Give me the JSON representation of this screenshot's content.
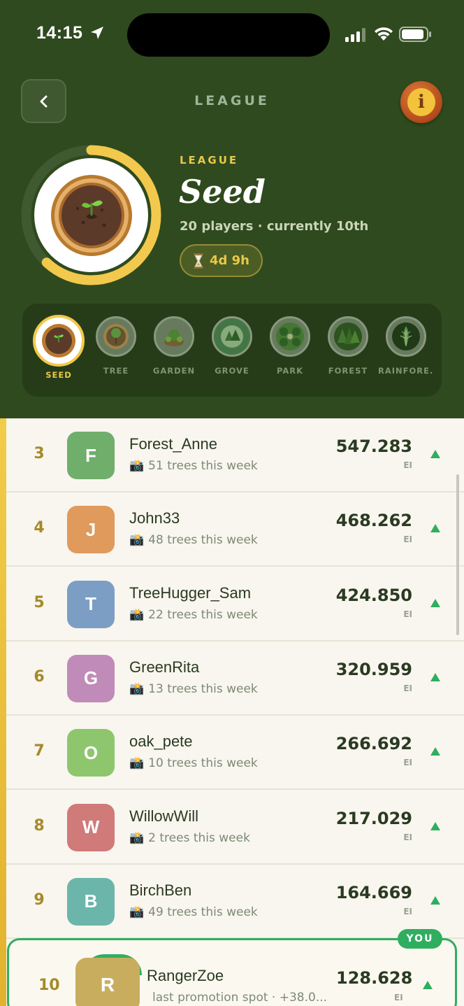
{
  "status_bar": {
    "time": "14:15"
  },
  "header": {
    "title": "LEAGUE",
    "back_icon": "chevron-left-icon",
    "info_icon": "info-icon"
  },
  "league": {
    "label": "LEAGUE",
    "name": "Seed",
    "subtitle": "20 players · currently 10th",
    "timer": "4d 9h",
    "progress_fraction": 0.62,
    "colors": {
      "ring": "#f2c94c",
      "ring_track": "#3f5a30"
    }
  },
  "tiers": [
    {
      "label": "SEED",
      "active": true
    },
    {
      "label": "TREE",
      "active": false
    },
    {
      "label": "GARDEN",
      "active": false
    },
    {
      "label": "GROVE",
      "active": false
    },
    {
      "label": "PARK",
      "active": false
    },
    {
      "label": "FOREST",
      "active": false
    },
    {
      "label": "RAINFORE...",
      "active": false
    }
  ],
  "leaderboard": [
    {
      "rank": "3",
      "initial": "F",
      "name": "Forest_Anne",
      "sub": "51 trees this week",
      "score": "547.283",
      "unit": "EI",
      "color": "#6fae6b"
    },
    {
      "rank": "4",
      "initial": "J",
      "name": "John33",
      "sub": "48 trees this week",
      "score": "468.262",
      "unit": "EI",
      "color": "#e09a5c"
    },
    {
      "rank": "5",
      "initial": "T",
      "name": "TreeHugger_Sam",
      "sub": "22 trees this week",
      "score": "424.850",
      "unit": "EI",
      "color": "#7d9ec4"
    },
    {
      "rank": "6",
      "initial": "G",
      "name": "GreenRita",
      "sub": "13 trees this week",
      "score": "320.959",
      "unit": "EI",
      "color": "#c08bb8"
    },
    {
      "rank": "7",
      "initial": "O",
      "name": "oak_pete",
      "sub": "10 trees this week",
      "score": "266.692",
      "unit": "EI",
      "color": "#8ec66e"
    },
    {
      "rank": "8",
      "initial": "W",
      "name": "WillowWill",
      "sub": "2 trees this week",
      "score": "217.029",
      "unit": "EI",
      "color": "#d07a7a"
    },
    {
      "rank": "9",
      "initial": "B",
      "name": "BirchBen",
      "sub": "49 trees this week",
      "score": "164.669",
      "unit": "EI",
      "color": "#6cb5aa"
    }
  ],
  "you": {
    "tag": "YOU",
    "rank": "10",
    "initial": "R",
    "name": "RangerZoe",
    "sub": "last promotion spot · +38.0...",
    "score": "128.628",
    "unit": "EI"
  }
}
